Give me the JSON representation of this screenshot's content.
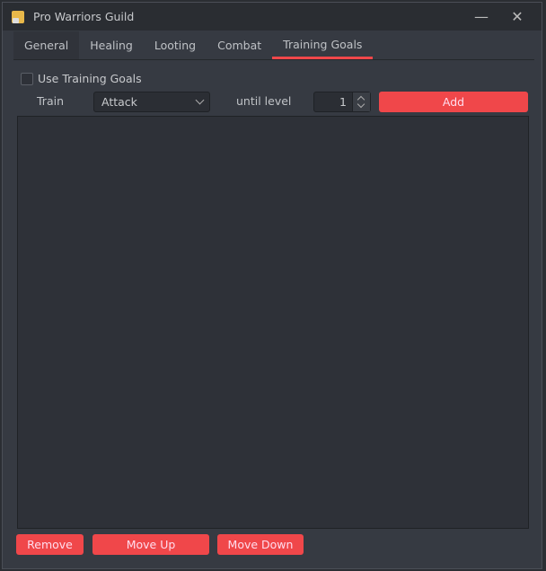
{
  "window": {
    "title": "Pro Warriors Guild",
    "minimize_icon": "minimize-icon",
    "close_icon": "close-icon"
  },
  "tabs": [
    {
      "label": "General"
    },
    {
      "label": "Healing"
    },
    {
      "label": "Looting"
    },
    {
      "label": "Combat"
    },
    {
      "label": "Training Goals",
      "active": true
    }
  ],
  "form": {
    "use_training_goals": "Use Training Goals",
    "checked": false,
    "train_label": "Train",
    "skill_selected": "Attack",
    "until_label": "until level",
    "level_value": "1",
    "add_label": "Add"
  },
  "goals_list": {
    "items": []
  },
  "actions": {
    "remove": "Remove",
    "move_up": "Move Up",
    "move_down": "Move Down"
  },
  "colors": {
    "accent": "#f0474a",
    "background": "#363a42",
    "titlebar": "#2a2d32"
  }
}
